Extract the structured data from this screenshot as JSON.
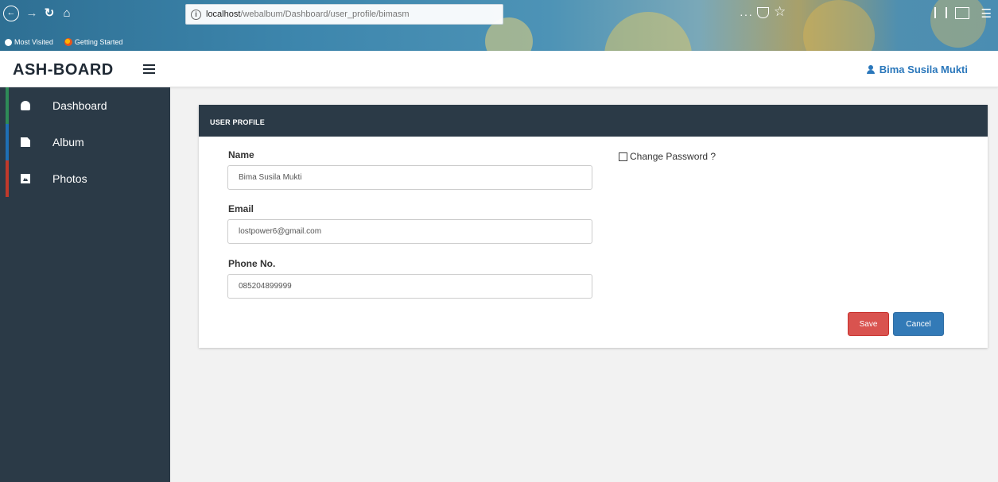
{
  "browser": {
    "url_host": "localhost",
    "url_path": "/webalbum/Dashboard/user_profile/bimasm",
    "overflow_label": "···",
    "bookmarks": [
      {
        "label": "Most Visited",
        "icon": "gear-icon"
      },
      {
        "label": "Getting Started",
        "icon": "firefox-icon"
      }
    ]
  },
  "header": {
    "brand": "ASH-BOARD",
    "user_name": "Bima Susila Mukti"
  },
  "sidebar": {
    "items": [
      {
        "label": "Dashboard",
        "icon": "dashboard-icon",
        "accent": "#2e8b57"
      },
      {
        "label": "Album",
        "icon": "file-icon",
        "accent": "#1e6fb5"
      },
      {
        "label": "Photos",
        "icon": "picture-icon",
        "accent": "#c0392b"
      }
    ]
  },
  "panel": {
    "title": "USER PROFILE",
    "name_label": "Name",
    "name_value": "Bima Susila Mukti",
    "email_label": "Email",
    "email_value": "lostpower6@gmail.com",
    "phone_label": "Phone No.",
    "phone_value": "085204899999",
    "change_password_label": "Change Password ?",
    "save_label": "Save",
    "cancel_label": "Cancel"
  },
  "colors": {
    "sidebar_bg": "#2b3a47",
    "link_blue": "#2a77bb",
    "save_red": "#d9534f",
    "cancel_blue": "#337ab7"
  }
}
